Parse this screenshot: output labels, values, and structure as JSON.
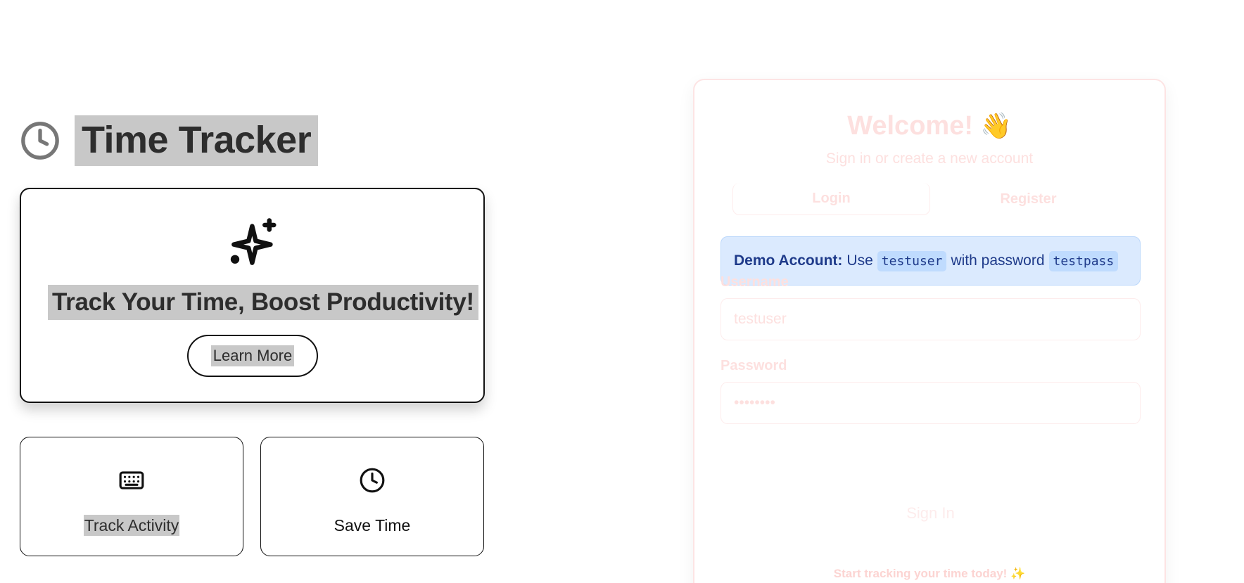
{
  "brand": {
    "title": "Time Tracker",
    "icon": "clock-icon"
  },
  "hero": {
    "icon": "sparkles-icon",
    "title": "Track Your Time, Boost Productivity!",
    "button_label": "Learn More"
  },
  "features": [
    {
      "icon": "keyboard-icon",
      "label": "Track Activity"
    },
    {
      "icon": "clock-icon",
      "label": "Save Time"
    }
  ],
  "auth": {
    "welcome": "Welcome!",
    "wave_emoji": "👋",
    "subtitle": "Sign in or create a new account",
    "tabs": [
      {
        "label": "Login",
        "active": true
      },
      {
        "label": "Register",
        "active": false
      }
    ],
    "demo": {
      "prefix": "Demo Account:",
      "use_text": "Use",
      "username": "testuser",
      "middle_text": "with password",
      "password": "testpass"
    },
    "username_label": "Username",
    "username_value": "testuser",
    "password_label": "Password",
    "password_value": "••••••••",
    "signin_label": "Sign In",
    "footer": "Start tracking your time today!",
    "footer_emoji": "✨"
  },
  "colors": {
    "highlight": "#c8c8c8",
    "demo_bg": "#dbeafe",
    "demo_text": "#1e3a8a",
    "faded_pink": "#fde0df"
  }
}
